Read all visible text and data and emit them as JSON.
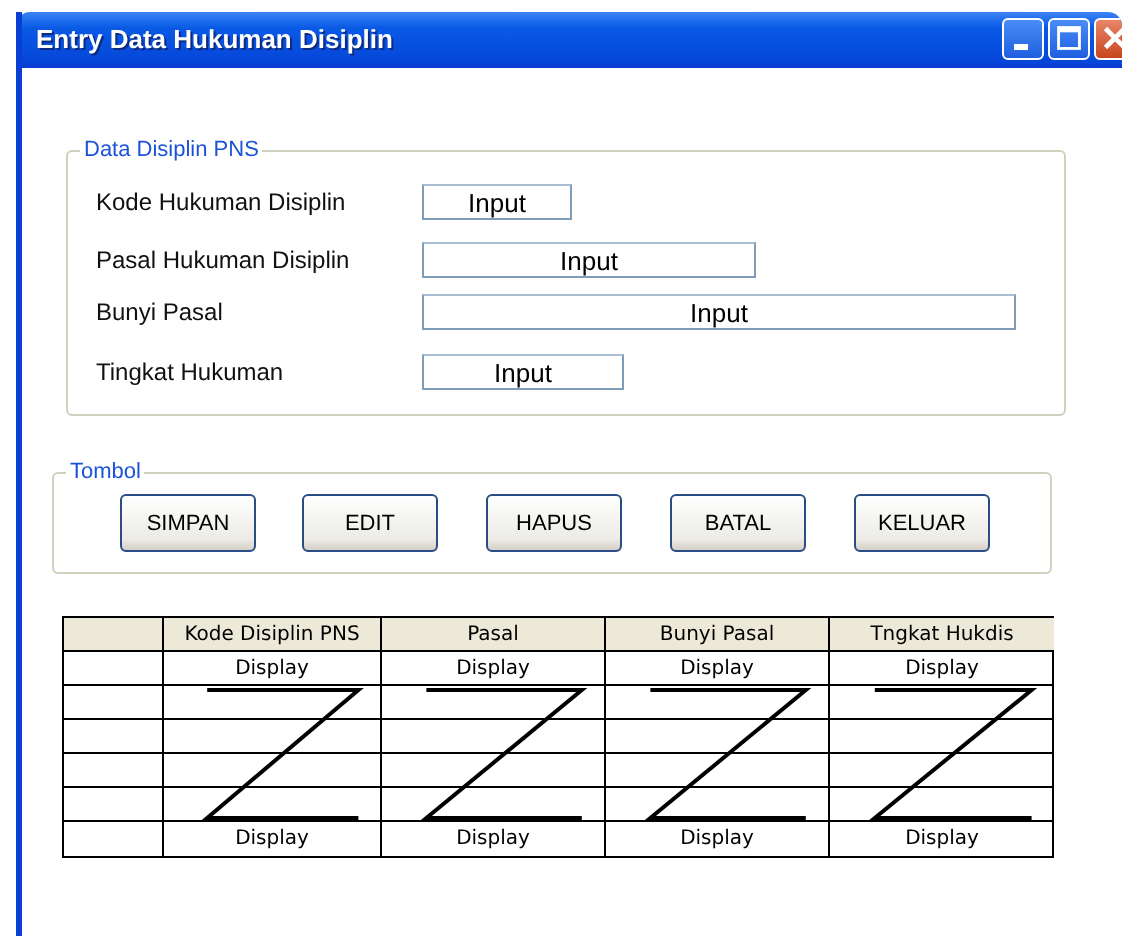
{
  "window": {
    "title": "Entry Data Hukuman Disiplin"
  },
  "form_group": {
    "legend": "Data Disiplin PNS",
    "fields": [
      {
        "label": "Kode Hukuman Disiplin",
        "value": "Input"
      },
      {
        "label": "Pasal Hukuman Disiplin",
        "value": "Input"
      },
      {
        "label": "Bunyi Pasal",
        "value": "Input"
      },
      {
        "label": "Tingkat Hukuman",
        "value": "Input"
      }
    ]
  },
  "button_group": {
    "legend": "Tombol",
    "buttons": [
      "SIMPAN",
      "EDIT",
      "HAPUS",
      "BATAL",
      "KELUAR"
    ]
  },
  "table": {
    "columns": [
      "Kode Disiplin PNS",
      "Pasal",
      "Bunyi Pasal",
      "Tngkat Hukdis"
    ],
    "rows": [
      {
        "cells": [
          "Display",
          "Display",
          "Display",
          "Display"
        ]
      },
      {
        "cells": [
          "Display",
          "Display",
          "Display",
          "Display"
        ]
      }
    ]
  }
}
